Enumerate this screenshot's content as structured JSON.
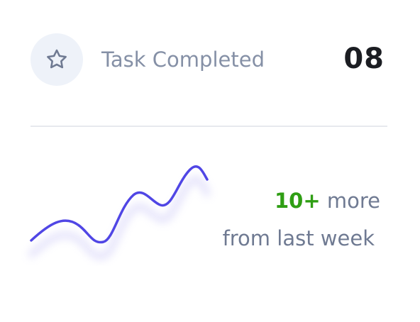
{
  "stat": {
    "title": "Task Completed",
    "count": "08",
    "icon": "star-icon"
  },
  "trend": {
    "delta": "10+",
    "delta_suffix": "more",
    "period": "from last week"
  },
  "colors": {
    "line": "#5046e5",
    "positive": "#2f9e14",
    "muted_text": "#6f7a92",
    "icon_bg": "#eef2f9"
  }
}
